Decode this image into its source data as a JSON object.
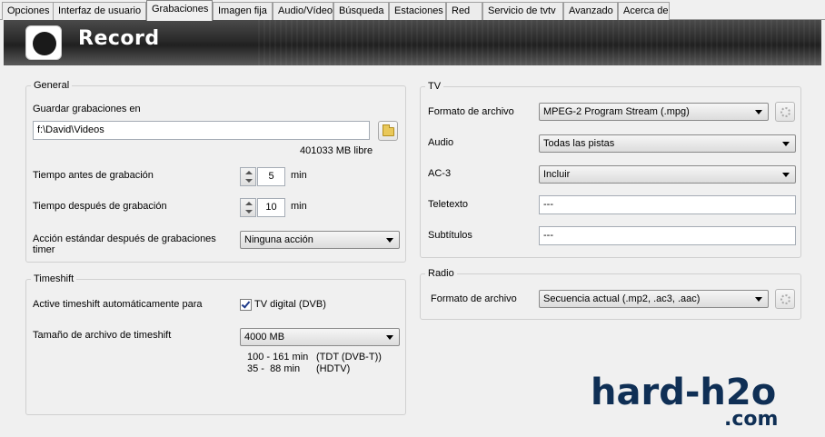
{
  "tabs": [
    {
      "label": "Opciones"
    },
    {
      "label": "Interfaz de usuario"
    },
    {
      "label": "Grabaciones"
    },
    {
      "label": "Imagen fija"
    },
    {
      "label": "Audio/Vídeo"
    },
    {
      "label": "Búsqueda"
    },
    {
      "label": "Estaciones"
    },
    {
      "label": "Red"
    },
    {
      "label": "Servicio de tvtv"
    },
    {
      "label": "Avanzado"
    },
    {
      "label": "Acerca de"
    }
  ],
  "active_tab": "Grabaciones",
  "header": {
    "title": "Record"
  },
  "general": {
    "title": "General",
    "save_label": "Guardar grabaciones en",
    "save_path": "f:\\David\\Videos",
    "free_space": "401033 MB libre",
    "before_label": "Tiempo antes de grabación",
    "before_value": "5",
    "before_unit": "min",
    "after_label": "Tiempo después de grabación",
    "after_value": "10",
    "after_unit": "min",
    "action_label_line1": "Acción estándar después de grabaciones",
    "action_label_line2": "timer",
    "action_value": "Ninguna acción"
  },
  "timeshift": {
    "title": "Timeshift",
    "auto_label": "Active timeshift automáticamente para",
    "auto_checkbox_label": "TV digital (DVB)",
    "auto_checked": true,
    "size_label": "Tamaño de archivo de timeshift",
    "size_value": "4000 MB",
    "info_row1_range": "100 - 161 min",
    "info_row1_desc": "(TDT (DVB-T))",
    "info_row2_range": "35 -  88 min",
    "info_row2_desc": "(HDTV)"
  },
  "tv": {
    "title": "TV",
    "format_label": "Formato de archivo",
    "format_value": "MPEG-2 Program Stream (.mpg)",
    "audio_label": "Audio",
    "audio_value": "Todas las pistas",
    "ac3_label": "AC-3",
    "ac3_value": "Incluir",
    "teletext_label": "Teletexto",
    "teletext_value": "---",
    "subtitles_label": "Subtítulos",
    "subtitles_value": "---"
  },
  "radio": {
    "title": "Radio",
    "format_label": "Formato de archivo",
    "format_value": "Secuencia actual (.mp2, .ac3, .aac)"
  },
  "watermark": {
    "line1": "hard-h2o",
    "line2": ".com"
  },
  "colors": {
    "watermark": "#0f2f55",
    "banner": "#2a2a2a"
  }
}
